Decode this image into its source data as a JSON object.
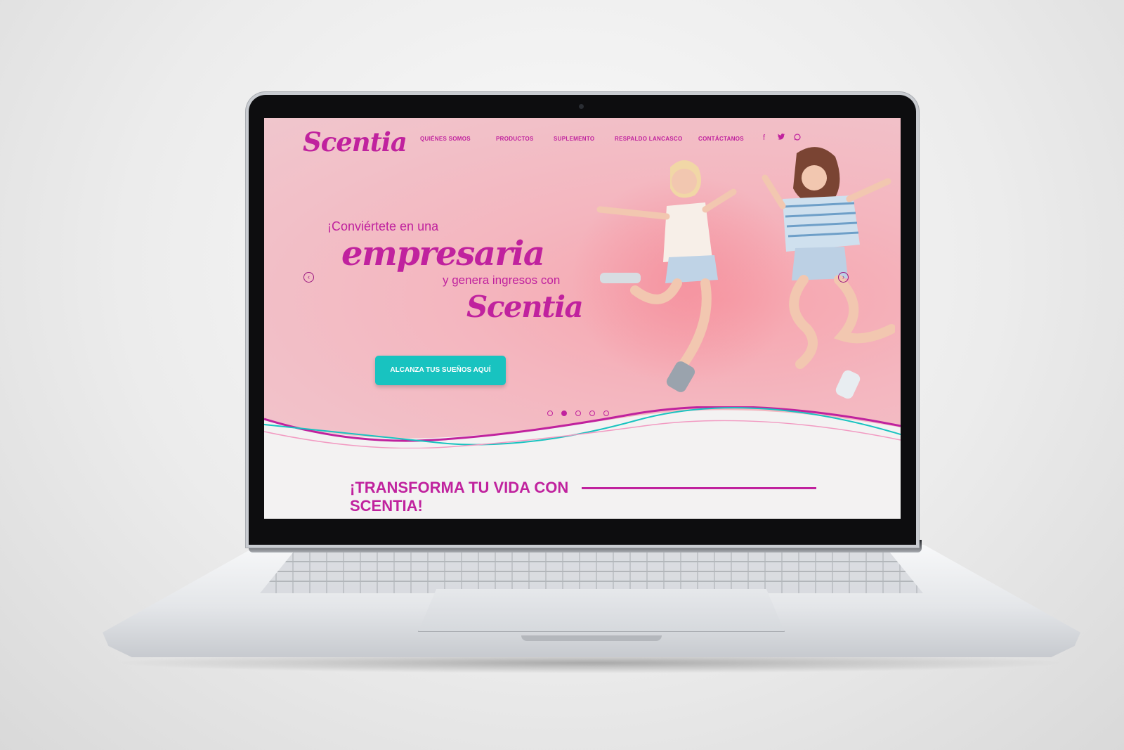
{
  "site": {
    "logo": "Scentia",
    "nav": [
      {
        "label": "QUIÉNES SOMOS"
      },
      {
        "label": "PRODUCTOS"
      },
      {
        "label": "SUPLEMENTO"
      },
      {
        "label": "RESPALDO LANCASCO"
      },
      {
        "label": "CONTÁCTANOS"
      }
    ],
    "social_icons": [
      "facebook-icon",
      "twitter-icon",
      "whatsapp-icon"
    ]
  },
  "hero": {
    "line1": "¡Conviértete en una",
    "line2": "empresaria",
    "line3": "y genera ingresos con",
    "line4": "Scentia",
    "cta_label": "ALCANZA TUS SUEÑOS AQUÍ",
    "slides_total": 5,
    "active_slide": 2
  },
  "section": {
    "title": "¡TRANSFORMA TU VIDA CON SCENTIA!"
  },
  "colors": {
    "brand_magenta": "#c0229e",
    "cta_teal": "#18c3c0",
    "hero_pink": "#f4b6bf"
  }
}
